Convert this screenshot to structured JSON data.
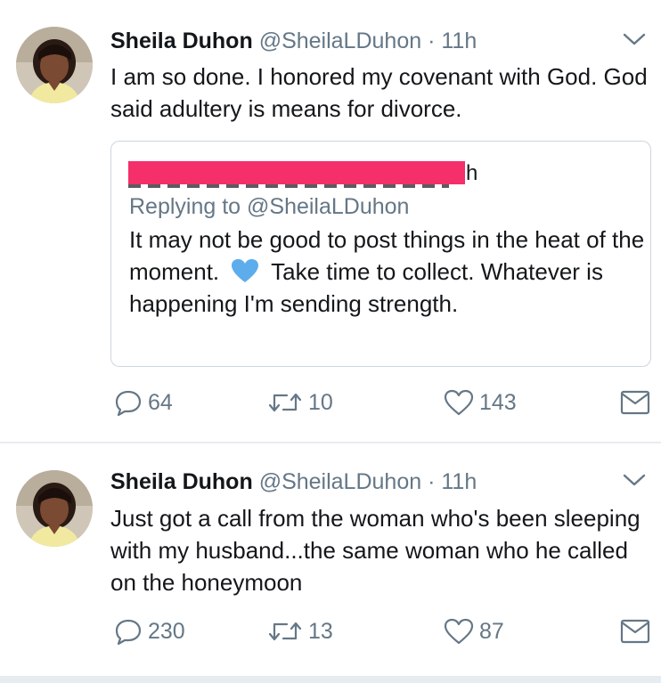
{
  "tweets": [
    {
      "name": "Sheila Duhon",
      "handle": "@SheilaLDuhon",
      "separator": "·",
      "time": "11h",
      "text": "I am so done. I honored my covenant with God. God said adultery is means for divorce.",
      "quote": {
        "redacted_tail": "h",
        "replying_to": "Replying to @SheilaLDuhon",
        "text_before_emoji": "It may not be good to post things in the heat of the moment.",
        "emoji": "blue-heart",
        "text_after_emoji": "Take time to collect.  Whatever is happening I'm sending strength."
      },
      "replies": "64",
      "retweets": "10",
      "likes": "143"
    },
    {
      "name": "Sheila Duhon",
      "handle": "@SheilaLDuhon",
      "separator": "·",
      "time": "11h",
      "text": "Just got a call from the woman who's been sleeping with my husband...the same woman who he called on the honeymoon",
      "replies": "230",
      "retweets": "13",
      "likes": "87"
    }
  ],
  "colors": {
    "text": "#14171a",
    "secondary": "#657786",
    "border": "#ccd6dd",
    "redaction": "#f42f6a",
    "heart_emoji": "#5dadec"
  },
  "icons": [
    "chevron-down-icon",
    "reply-icon",
    "retweet-icon",
    "like-icon",
    "direct-message-icon"
  ]
}
